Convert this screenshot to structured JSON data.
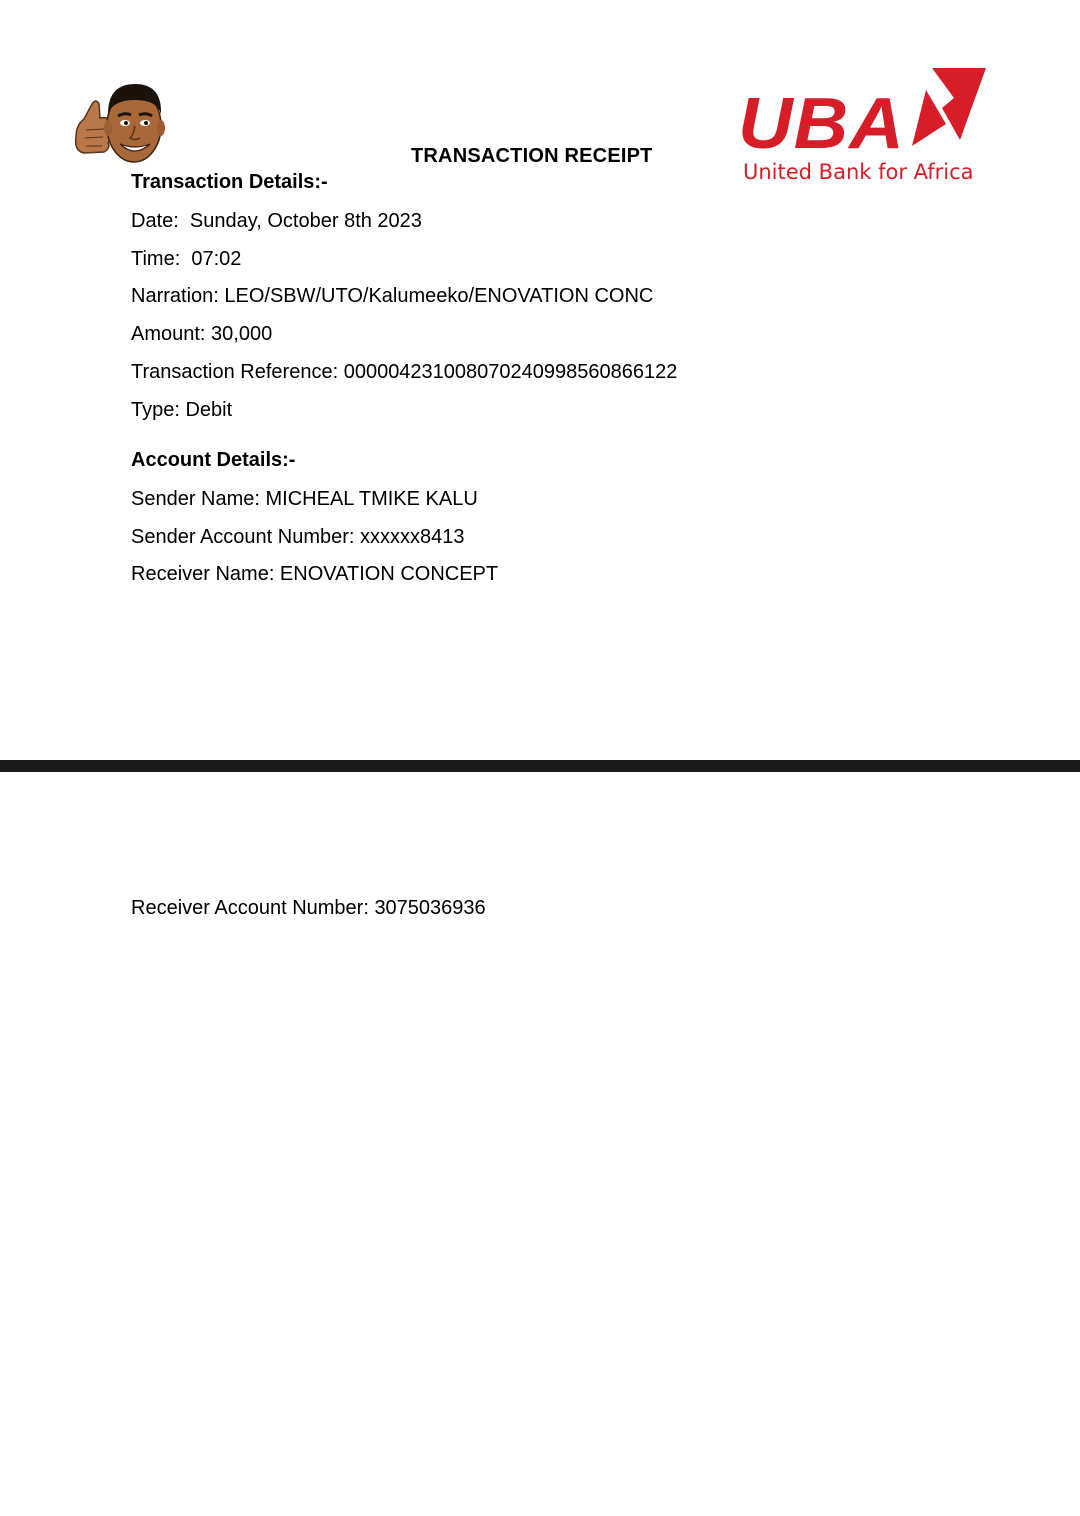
{
  "receipt": {
    "title": "TRANSACTION RECEIPT"
  },
  "logo": {
    "wordmark": "UBA",
    "tagline": "United Bank for Africa",
    "color": "#d71e28"
  },
  "transaction": {
    "heading": "Transaction Details:-",
    "date": "Date:  Sunday, October 8th 2023",
    "time": "Time:  07:02",
    "narration": "Narration: LEO/SBW/UTO/Kalumeeko/ENOVATION CONC",
    "amount": "Amount: 30,000",
    "reference": "Transaction Reference: 000004231008070240998560866122",
    "type": "Type: Debit"
  },
  "account": {
    "heading": "Account Details:-",
    "sender_name": "Sender Name: MICHEAL TMIKE KALU",
    "sender_account": "Sender Account Number: xxxxxx8413",
    "receiver_name": "Receiver Name: ENOVATION CONCEPT",
    "receiver_account": "Receiver Account Number: 3075036936"
  },
  "icons": {
    "avatar": "thumbs-up-avatar-icon",
    "logo_mark": "uba-logo-mark-icon"
  }
}
